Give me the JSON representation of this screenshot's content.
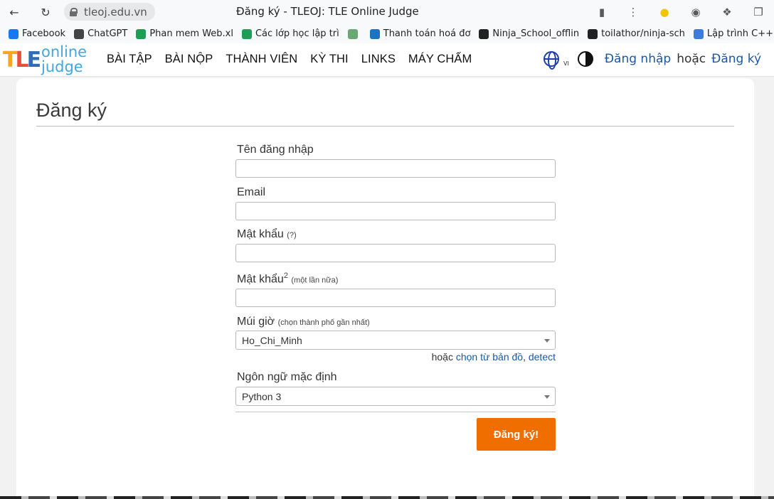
{
  "browser": {
    "url": "tleoj.edu.vn",
    "tab_title": "Đăng ký - TLEOJ: TLE Online Judge"
  },
  "bookmarks": [
    {
      "label": "Facebook",
      "color": "#1877f2"
    },
    {
      "label": "ChatGPT",
      "color": "#444444"
    },
    {
      "label": "Phan mem Web.xl",
      "color": "#1f9d55"
    },
    {
      "label": "Các lớp học lập trì",
      "color": "#1f9d55"
    },
    {
      "label": "",
      "color": "#6aa874"
    },
    {
      "label": "Thanh toán hoá đơ",
      "color": "#1e73be"
    },
    {
      "label": "Ninja_School_offlin",
      "color": "#222222"
    },
    {
      "label": "toilathor/ninja-sch",
      "color": "#222222"
    },
    {
      "label": "Lập trình C++ cơ bả",
      "color": "#3d7bd9"
    }
  ],
  "site": {
    "logo_text_line1": "online",
    "logo_text_line2": "judge",
    "nav": [
      "BÀI TẬP",
      "BÀI NỘP",
      "THÀNH VIÊN",
      "KỲ THI",
      "LINKS",
      "MÁY CHẤM"
    ],
    "lang_code": "VI",
    "login_label": "Đăng nhập",
    "or_label": "hoặc",
    "register_label": "Đăng ký"
  },
  "page": {
    "title": "Đăng ký"
  },
  "form": {
    "username_label": "Tên đăng nhập",
    "email_label": "Email",
    "password_label": "Mật khẩu",
    "password_hint": "(?)",
    "password2_label": "Mật khẩu",
    "password2_sup": "2",
    "password2_hint": "(một lần nữa)",
    "timezone_label": "Múi giờ",
    "timezone_hint": "(chọn thành phố gần nhất)",
    "timezone_value": "Ho_Chi_Minh",
    "tz_or": "hoặc",
    "tz_map_link": "chọn từ bản đồ",
    "tz_comma": ",",
    "tz_detect_link": "detect",
    "language_label": "Ngôn ngữ mặc định",
    "language_value": "Python 3",
    "submit_label": "Đăng ký!"
  }
}
